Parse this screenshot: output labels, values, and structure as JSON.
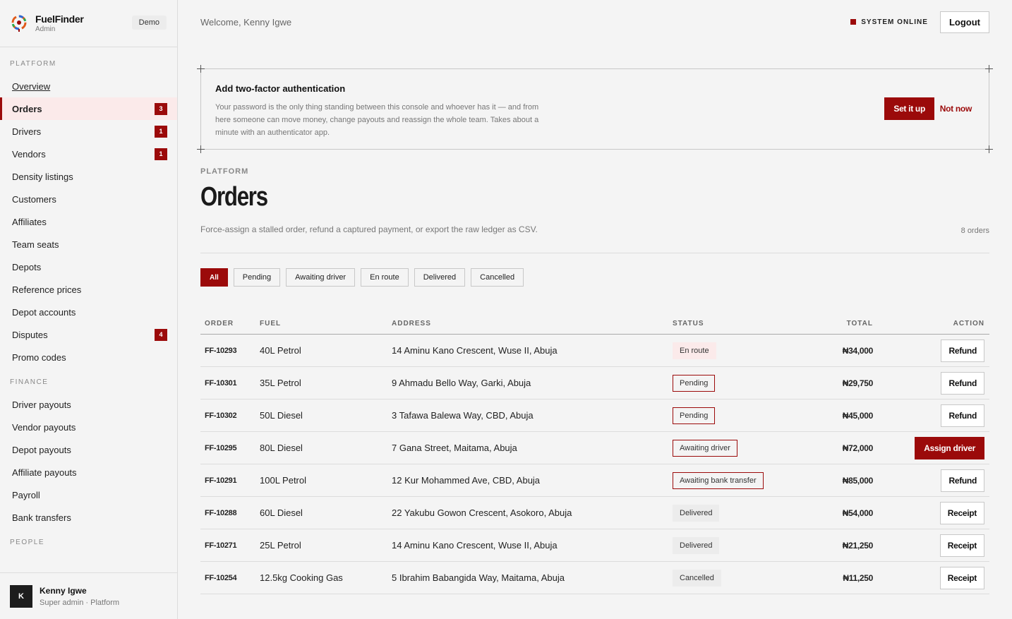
{
  "brand": {
    "name": "FuelFinder",
    "sub": "Admin",
    "badge": "Demo"
  },
  "nav": {
    "platform_label": "PLATFORM",
    "platform": [
      {
        "label": "Overview",
        "badge": ""
      },
      {
        "label": "Orders",
        "badge": "3"
      },
      {
        "label": "Drivers",
        "badge": "1"
      },
      {
        "label": "Vendors",
        "badge": "1"
      },
      {
        "label": "Density listings",
        "badge": ""
      },
      {
        "label": "Customers",
        "badge": ""
      },
      {
        "label": "Affiliates",
        "badge": ""
      },
      {
        "label": "Team seats",
        "badge": ""
      },
      {
        "label": "Depots",
        "badge": ""
      },
      {
        "label": "Reference prices",
        "badge": ""
      },
      {
        "label": "Depot accounts",
        "badge": ""
      },
      {
        "label": "Disputes",
        "badge": "4"
      },
      {
        "label": "Promo codes",
        "badge": ""
      }
    ],
    "finance_label": "FINANCE",
    "finance": [
      {
        "label": "Driver payouts"
      },
      {
        "label": "Vendor payouts"
      },
      {
        "label": "Depot payouts"
      },
      {
        "label": "Affiliate payouts"
      },
      {
        "label": "Payroll"
      },
      {
        "label": "Bank transfers"
      }
    ],
    "people_label": "PEOPLE"
  },
  "user": {
    "initial": "K",
    "name": "Kenny Igwe",
    "role": "Super admin · Platform"
  },
  "topbar": {
    "welcome": "Welcome, Kenny Igwe",
    "status": "SYSTEM ONLINE",
    "logout": "Logout"
  },
  "twofa": {
    "title": "Add two-factor authentication",
    "body": "Your password is the only thing standing between this console and whoever has it — and from here someone can move money, change payouts and reassign the whole team. Takes about a minute with an authenticator app.",
    "setup": "Set it up",
    "notnow": "Not now"
  },
  "page": {
    "section": "PLATFORM",
    "title": "Orders",
    "description": "Force-assign a stalled order, refund a captured payment, or export the raw ledger as CSV.",
    "count": "8 orders"
  },
  "filters": [
    "All",
    "Pending",
    "Awaiting driver",
    "En route",
    "Delivered",
    "Cancelled"
  ],
  "table": {
    "headers": {
      "order": "ORDER",
      "fuel": "FUEL",
      "address": "ADDRESS",
      "status": "STATUS",
      "total": "TOTAL",
      "action": "ACTION"
    },
    "rows": [
      {
        "order": "FF-10293",
        "fuel": "40L Petrol",
        "address": "14 Aminu Kano Crescent, Wuse II, Abuja",
        "status": "En route",
        "status_kind": "enroute",
        "total": "₦34,000",
        "action": "Refund",
        "action_kind": "default"
      },
      {
        "order": "FF-10301",
        "fuel": "35L Petrol",
        "address": "9 Ahmadu Bello Way, Garki, Abuja",
        "status": "Pending",
        "status_kind": "pending",
        "total": "₦29,750",
        "action": "Refund",
        "action_kind": "default"
      },
      {
        "order": "FF-10302",
        "fuel": "50L Diesel",
        "address": "3 Tafawa Balewa Way, CBD, Abuja",
        "status": "Pending",
        "status_kind": "pending",
        "total": "₦45,000",
        "action": "Refund",
        "action_kind": "default"
      },
      {
        "order": "FF-10295",
        "fuel": "80L Diesel",
        "address": "7 Gana Street, Maitama, Abuja",
        "status": "Awaiting driver",
        "status_kind": "pending",
        "total": "₦72,000",
        "action": "Assign driver",
        "action_kind": "primary"
      },
      {
        "order": "FF-10291",
        "fuel": "100L Petrol",
        "address": "12 Kur Mohammed Ave, CBD, Abuja",
        "status": "Awaiting bank transfer",
        "status_kind": "pending",
        "total": "₦85,000",
        "action": "Refund",
        "action_kind": "default"
      },
      {
        "order": "FF-10288",
        "fuel": "60L Diesel",
        "address": "22 Yakubu Gowon Crescent, Asokoro, Abuja",
        "status": "Delivered",
        "status_kind": "delivered",
        "total": "₦54,000",
        "action": "Receipt",
        "action_kind": "default"
      },
      {
        "order": "FF-10271",
        "fuel": "25L Petrol",
        "address": "14 Aminu Kano Crescent, Wuse II, Abuja",
        "status": "Delivered",
        "status_kind": "delivered",
        "total": "₦21,250",
        "action": "Receipt",
        "action_kind": "default"
      },
      {
        "order": "FF-10254",
        "fuel": "12.5kg Cooking Gas",
        "address": "5 Ibrahim Babangida Way, Maitama, Abuja",
        "status": "Cancelled",
        "status_kind": "cancelled",
        "total": "₦11,250",
        "action": "Receipt",
        "action_kind": "default"
      }
    ]
  },
  "colors": {
    "accent": "#9b0a0a",
    "accent_soft": "#fbeaea"
  }
}
